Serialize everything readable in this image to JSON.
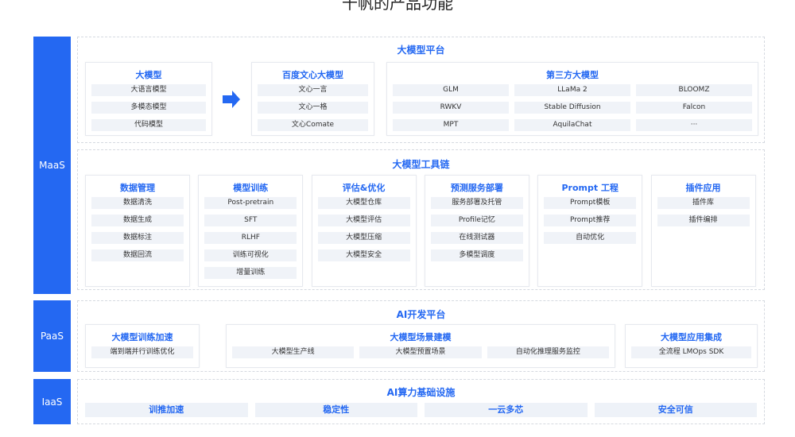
{
  "page_title": "千帆的产品功能",
  "layers": {
    "maas": "MaaS",
    "paas": "PaaS",
    "iaas": "IaaS"
  },
  "platform": {
    "title": "大模型平台",
    "big_model": {
      "title": "大模型",
      "items": [
        "大语言模型",
        "多模态模型",
        "代码模型"
      ]
    },
    "baidu": {
      "title": "百度文心大模型",
      "items": [
        "文心一言",
        "文心一格",
        "文心Comate"
      ]
    },
    "third": {
      "title": "第三方大模型",
      "items": [
        "GLM",
        "LLaMa 2",
        "BLOOMZ",
        "RWKV",
        "Stable Diffusion",
        "Falcon",
        "MPT",
        "AquilaChat",
        "···"
      ]
    }
  },
  "toolchain": {
    "title": "大模型工具链",
    "columns": [
      {
        "title": "数据管理",
        "items": [
          "数据清洗",
          "数据生成",
          "数据标注",
          "数据回流"
        ]
      },
      {
        "title": "模型训练",
        "items": [
          "Post-pretrain",
          "SFT",
          "RLHF",
          "训练可视化",
          "增量训练"
        ]
      },
      {
        "title": "评估&优化",
        "items": [
          "大模型仓库",
          "大模型评估",
          "大模型压缩",
          "大模型安全"
        ]
      },
      {
        "title": "预测服务部署",
        "items": [
          "服务部署及托管",
          "Profile记忆",
          "在线测试器",
          "多模型调度"
        ]
      },
      {
        "title": "Prompt 工程",
        "items": [
          "Prompt模板",
          "Prompt推荐",
          "自动优化"
        ]
      },
      {
        "title": "插件应用",
        "items": [
          "插件库",
          "插件编排"
        ]
      }
    ]
  },
  "paas": {
    "title": "AI开发平台",
    "train": {
      "title": "大模型训练加速",
      "items": [
        "端到端并行训练优化"
      ]
    },
    "scene": {
      "title": "大模型场景建模",
      "items": [
        "大模型生产线",
        "大模型预置场景",
        "自动化推理服务监控"
      ]
    },
    "integrate": {
      "title": "大模型应用集成",
      "items": [
        "全流程 LMOps SDK"
      ]
    }
  },
  "iaas": {
    "title": "AI算力基础设施",
    "items": [
      "训推加速",
      "稳定性",
      "一云多芯",
      "安全可信"
    ]
  }
}
